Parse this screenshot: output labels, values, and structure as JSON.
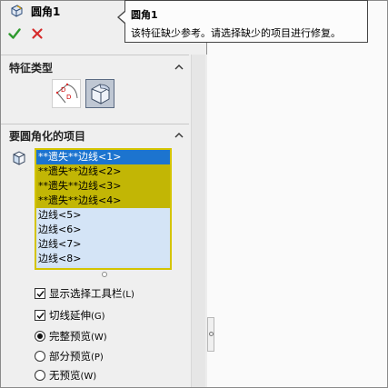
{
  "header": {
    "title": "圆角1"
  },
  "tooltip": {
    "title": "圆角1",
    "message": "该特征缺少参考。请选择缺少的项目进行修复。"
  },
  "sections": {
    "feature_type": {
      "title": "特征类型"
    },
    "items_to_fillet": {
      "title": "要圆角化的项目"
    }
  },
  "items_list": [
    {
      "label": "**遗失**边线<1>",
      "state": "selected"
    },
    {
      "label": "**遗失**边线<2>",
      "state": "missing"
    },
    {
      "label": "**遗失**边线<3>",
      "state": "missing"
    },
    {
      "label": "**遗失**边线<4>",
      "state": "missing"
    },
    {
      "label": "边线<5>",
      "state": "edge"
    },
    {
      "label": "边线<6>",
      "state": "edge"
    },
    {
      "label": "边线<7>",
      "state": "edge"
    },
    {
      "label": "边线<8>",
      "state": "edge"
    }
  ],
  "options": {
    "show_toolbar": {
      "label": "显示选择工具栏",
      "shortcut": "(L)",
      "checked": true
    },
    "tangent_propagation": {
      "label": "切线延伸",
      "shortcut": "(G)",
      "checked": true
    },
    "full_preview": {
      "label": "完整预览",
      "shortcut": "(W)",
      "selected": true
    },
    "partial_preview": {
      "label": "部分预览",
      "shortcut": "(P)",
      "selected": false
    },
    "no_preview": {
      "label": "无预览",
      "shortcut": "(W)",
      "selected": false
    }
  },
  "colors": {
    "selected_row": "#1c74cf",
    "missing_row": "#c2b605",
    "edge_row": "#d4e4f6",
    "list_border": "#d4c400",
    "ok_green": "#2e9a2e",
    "cancel_red": "#d62b2b"
  },
  "icons": {
    "header": "fillet-feature-icon",
    "ok": "checkmark-icon",
    "cancel": "close-icon",
    "type_constant": "constant-size-fillet-icon",
    "type_variable": "face-fillet-icon",
    "list": "edge-face-icon"
  }
}
